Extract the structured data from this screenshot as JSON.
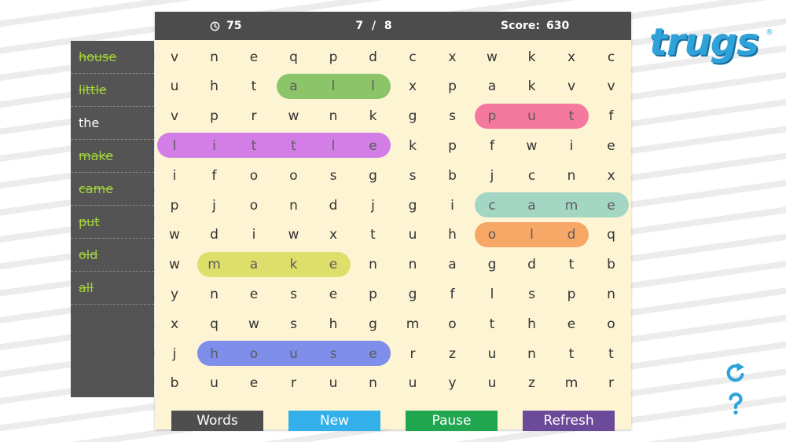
{
  "header": {
    "timer": "75",
    "progress": "7 / 8",
    "score_label": "Score:",
    "score": "630"
  },
  "words": [
    {
      "text": "house",
      "found": true
    },
    {
      "text": "little",
      "found": true
    },
    {
      "text": "the",
      "found": false
    },
    {
      "text": "make",
      "found": true
    },
    {
      "text": "came",
      "found": true
    },
    {
      "text": "put",
      "found": true
    },
    {
      "text": "old",
      "found": true
    },
    {
      "text": "all",
      "found": true
    }
  ],
  "grid": [
    "vneqpdcxwkxc",
    "uhtallxpakvv",
    "vprwnkgsputf",
    "littlekpfwie",
    "ifoosgsbjcnx",
    "pjondjgicame",
    "wdiwxtuholdq",
    "wmakennagdtb",
    "ynesepgflspn",
    "xqwshgmotheo",
    "jhouserzuntt",
    "buerunuyuzmr"
  ],
  "highlights": [
    {
      "word": "all",
      "row": 1,
      "c0": 3,
      "c1": 5,
      "color": "#8cc46a"
    },
    {
      "word": "put",
      "row": 2,
      "c0": 8,
      "c1": 10,
      "color": "#f5799e"
    },
    {
      "word": "little",
      "row": 3,
      "c0": 0,
      "c1": 5,
      "color": "#d27ee6"
    },
    {
      "word": "came",
      "row": 5,
      "c0": 8,
      "c1": 11,
      "color": "#a3d7c4"
    },
    {
      "word": "old",
      "row": 6,
      "c0": 8,
      "c1": 10,
      "color": "#f7a766"
    },
    {
      "word": "make",
      "row": 7,
      "c0": 1,
      "c1": 4,
      "color": "#dede6b"
    },
    {
      "word": "house",
      "row": 10,
      "c0": 1,
      "c1": 5,
      "color": "#7e8eea"
    }
  ],
  "buttons": [
    {
      "name": "words",
      "label": "Words",
      "color": "#4e4e4e"
    },
    {
      "name": "new",
      "label": "New",
      "color": "#33b0ea"
    },
    {
      "name": "pause",
      "label": "Pause",
      "color": "#1fa64f"
    },
    {
      "name": "refresh",
      "label": "Refresh",
      "color": "#6b4a9a"
    }
  ],
  "logo": {
    "text": "trugs",
    "mark": "®",
    "color": "#2fa3d9"
  },
  "icons": {
    "timer": "clock-icon",
    "refresh": "refresh-icon",
    "help": "help-icon"
  }
}
